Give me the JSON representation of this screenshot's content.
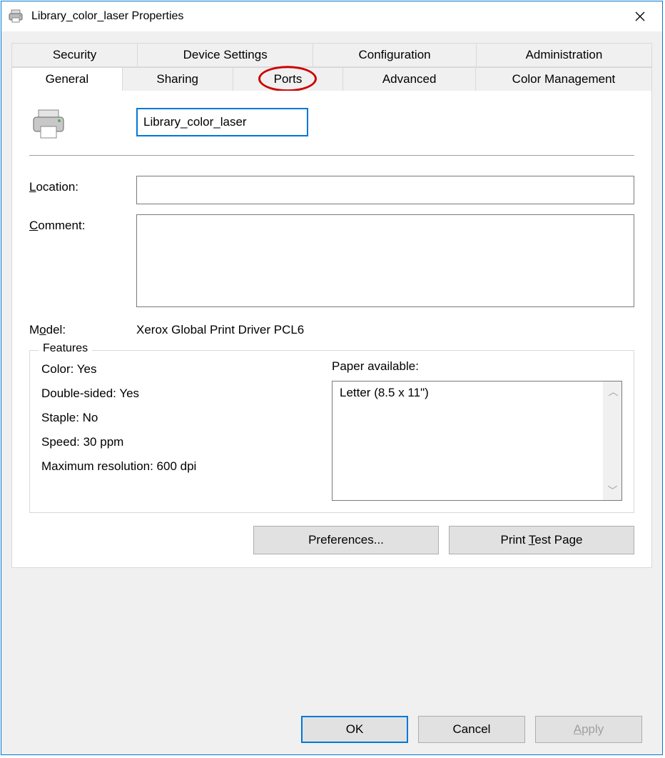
{
  "window": {
    "title": "Library_color_laser Properties"
  },
  "tabs": {
    "back": [
      {
        "label": "Security"
      },
      {
        "label": "Device Settings"
      },
      {
        "label": "Configuration"
      },
      {
        "label": "Administration"
      }
    ],
    "front": [
      {
        "label": "General",
        "active": true
      },
      {
        "label": "Sharing"
      },
      {
        "label": "Ports",
        "circled": true
      },
      {
        "label": "Advanced"
      },
      {
        "label": "Color Management"
      }
    ]
  },
  "general": {
    "printer_name": "Library_color_laser",
    "location_label": "Location:",
    "location_value": "",
    "comment_label": "Comment:",
    "comment_value": "",
    "model_label": "Model:",
    "model_value": "Xerox Global Print Driver PCL6"
  },
  "features": {
    "legend": "Features",
    "color": "Color: Yes",
    "double_sided": "Double-sided: Yes",
    "staple": "Staple: No",
    "speed": "Speed: 30 ppm",
    "max_res": "Maximum resolution: 600 dpi",
    "paper_label": "Paper available:",
    "paper_items": [
      "Letter (8.5 x 11\")"
    ]
  },
  "buttons": {
    "preferences": "Preferences...",
    "test_page_pre": "Print ",
    "test_page_u": "T",
    "test_page_post": "est Page",
    "ok": "OK",
    "cancel": "Cancel",
    "apply_u": "A",
    "apply_post": "pply"
  }
}
